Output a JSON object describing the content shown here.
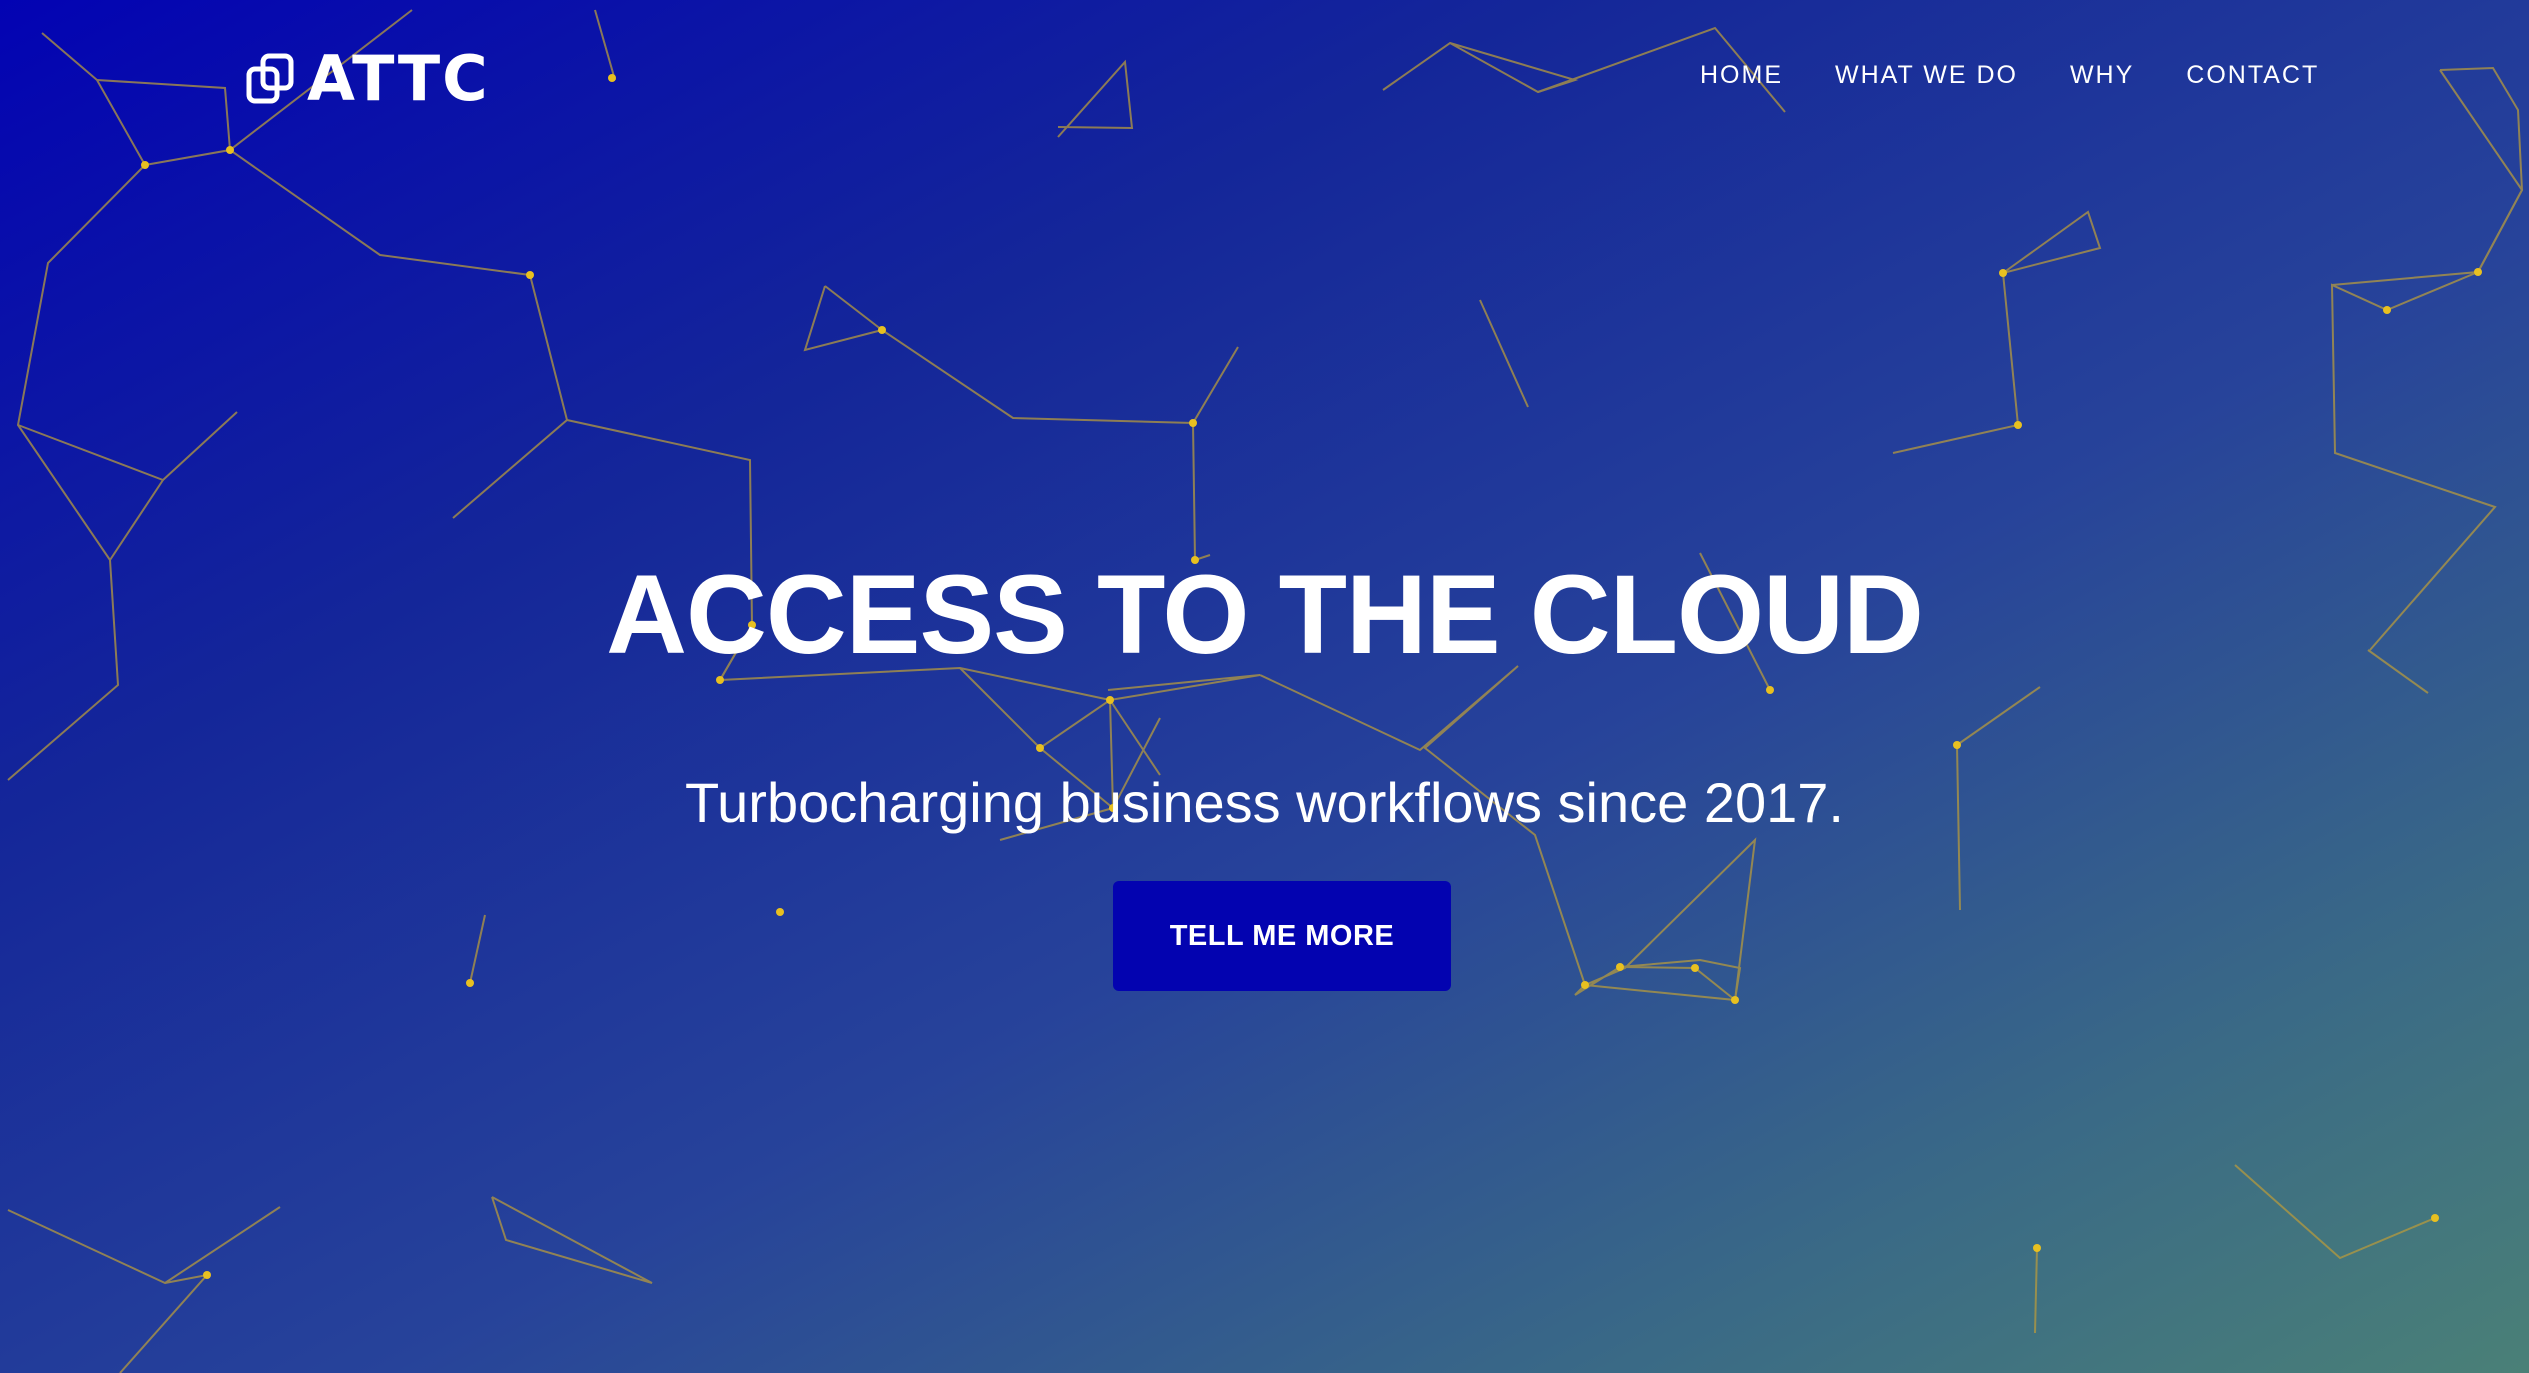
{
  "brand": {
    "name": "ATTC",
    "icon": "interlocked-squares-logo-icon"
  },
  "nav": {
    "items": [
      "HOME",
      "WHAT WE DO",
      "WHY",
      "CONTACT"
    ]
  },
  "hero": {
    "title": "ACCESS TO THE CLOUD",
    "subtitle": "Turbocharging business workflows since 2017.",
    "cta_label": "TELL ME MORE"
  },
  "colors": {
    "gradient_start": "#0303b3",
    "gradient_end": "#4a8077",
    "cta_background": "#0303b0",
    "network_line": "#b59a3e",
    "network_node": "#e8c020",
    "text": "#ffffff"
  }
}
